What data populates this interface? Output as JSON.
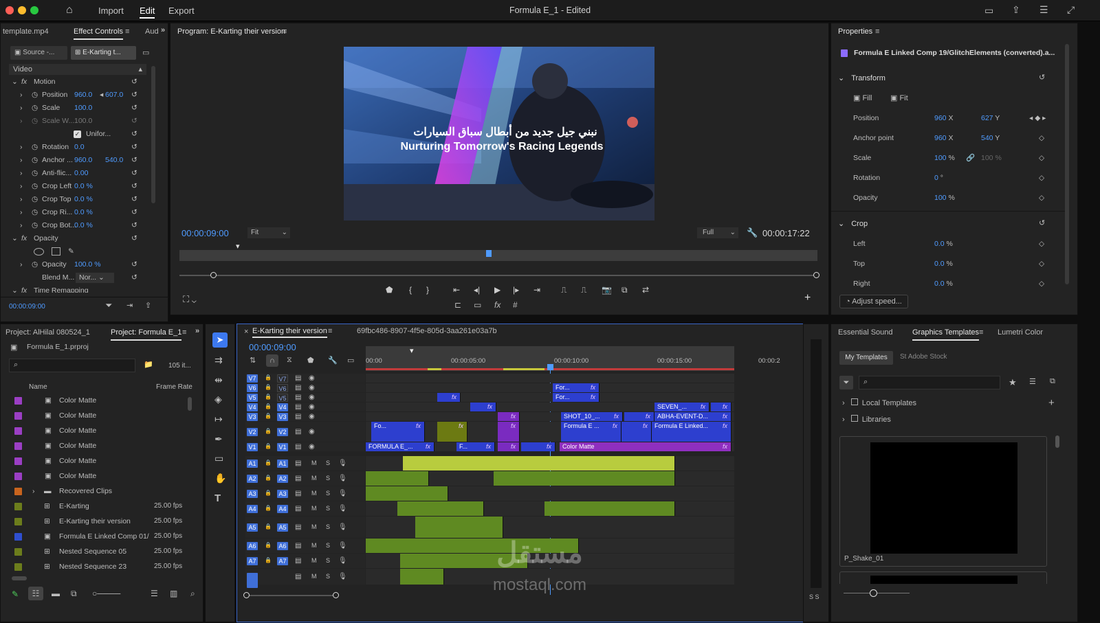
{
  "app": {
    "window_title": "Formula E_1 - Edited",
    "menu": [
      "Import",
      "Edit",
      "Export"
    ],
    "active_menu": "Edit"
  },
  "effect_controls": {
    "tabs": [
      "template.mp4",
      "Effect Controls",
      "Aud"
    ],
    "source_label": "Source -...",
    "clip_label": "E-Karting t...",
    "section": "Video",
    "timecode": "00:00:09:00",
    "rows": [
      {
        "label": "Motion",
        "value": "",
        "value2": ""
      },
      {
        "label": "Position",
        "value": "960.0",
        "value2": "607.0"
      },
      {
        "label": "Scale",
        "value": "100.0",
        "value2": ""
      },
      {
        "label": "Scale W...",
        "value": "100.0",
        "value2": ""
      },
      {
        "label": "Unifor...",
        "value": "",
        "value2": ""
      },
      {
        "label": "Rotation",
        "value": "0.0",
        "value2": ""
      },
      {
        "label": "Anchor ...",
        "value": "960.0",
        "value2": "540.0"
      },
      {
        "label": "Anti-flic...",
        "value": "0.00",
        "value2": ""
      },
      {
        "label": "Crop Left",
        "value": "0.0 %",
        "value2": ""
      },
      {
        "label": "Crop Top",
        "value": "0.0 %",
        "value2": ""
      },
      {
        "label": "Crop Ri...",
        "value": "0.0 %",
        "value2": ""
      },
      {
        "label": "Crop Bot...",
        "value": "0.0 %",
        "value2": ""
      },
      {
        "label": "Opacity",
        "value": "",
        "value2": ""
      },
      {
        "label": "Opacity",
        "value": "100.0 %",
        "value2": ""
      },
      {
        "label": "Blend M...",
        "value": "Nor...",
        "value2": ""
      },
      {
        "label": "Time Remapping",
        "value": "",
        "value2": ""
      }
    ]
  },
  "program": {
    "title": "Program: E-Karting their version",
    "timecode": "00:00:09:00",
    "zoom": "Fit",
    "resolution": "Full",
    "duration": "00:00:17:22",
    "overlay_arabic": "نبني جيل جديد من أبطال سباق السيارات",
    "overlay_english": "Nurturing Tomorrow's Racing Legends"
  },
  "properties": {
    "title": "Properties",
    "clip": "Formula E Linked Comp 19/GlitchElements (converted).a...",
    "transform_title": "Transform",
    "fill": "Fill",
    "fit": "Fit",
    "position_label": "Position",
    "position_x": "960",
    "position_y": "627",
    "anchor_label": "Anchor point",
    "anchor_x": "960",
    "anchor_y": "540",
    "scale_label": "Scale",
    "scale_value": "100",
    "scale_value2": "100",
    "rotation_label": "Rotation",
    "rotation_value": "0",
    "opacity_label": "Opacity",
    "opacity_value": "100",
    "crop_title": "Crop",
    "left_label": "Left",
    "left_value": "0.0",
    "top_label": "Top",
    "top_value": "0.0",
    "right_label": "Right",
    "right_value": "0.0",
    "x_unit": "X",
    "y_unit": "Y",
    "pct": "%",
    "deg": "°",
    "adjust_speed": "Adjust speed..."
  },
  "project": {
    "tabs": [
      "Project: AlHilal 080524_1",
      "Project: Formula E_1"
    ],
    "file": "Formula E_1.prproj",
    "count": "105 it...",
    "col_name": "Name",
    "col_rate": "Frame Rate",
    "items": [
      {
        "name": "Color Matte",
        "rate": "",
        "color": "#9b3fc4"
      },
      {
        "name": "Color Matte",
        "rate": "",
        "color": "#9b3fc4"
      },
      {
        "name": "Color Matte",
        "rate": "",
        "color": "#9b3fc4"
      },
      {
        "name": "Color Matte",
        "rate": "",
        "color": "#9b3fc4"
      },
      {
        "name": "Color Matte",
        "rate": "",
        "color": "#9b3fc4"
      },
      {
        "name": "Color Matte",
        "rate": "",
        "color": "#9b3fc4"
      },
      {
        "name": "Recovered Clips",
        "rate": "",
        "color": "#c8641e"
      },
      {
        "name": "E-Karting",
        "rate": "25.00 fps",
        "color": "#6c7d1c"
      },
      {
        "name": "E-Karting their version",
        "rate": "25.00 fps",
        "color": "#6c7d1c"
      },
      {
        "name": "Formula E Linked Comp 01/",
        "rate": "25.00 fps",
        "color": "#2f4fcf"
      },
      {
        "name": "Nested Sequence 05",
        "rate": "25.00 fps",
        "color": "#6c7d1c"
      },
      {
        "name": "Nested Sequence 23",
        "rate": "25.00 fps",
        "color": "#6c7d1c"
      }
    ]
  },
  "timeline": {
    "tab": "E-Karting their version",
    "tab2": "69fbc486-8907-4f5e-805d-3aa261e03a7b",
    "timecode": "00:00:09:00",
    "ruler": [
      "00:00",
      "00:00:05:00",
      "00:00:10:00",
      "00:00:15:00",
      "00:00:2"
    ],
    "video_tracks": [
      "V7",
      "V6",
      "V5",
      "V4",
      "V3",
      "V2",
      "V1"
    ],
    "audio_tracks": [
      "A1",
      "A2",
      "A3",
      "A4",
      "A5",
      "A6",
      "A7"
    ],
    "m": "M",
    "s": "S",
    "clips": {
      "v6a": "For...",
      "v5a": "For...",
      "v4a": "SEVEN_...",
      "v3a": "SHOT_10_...",
      "v3b": "ABHA-EVENT-D...",
      "v2a": "Fo...",
      "v2b": "Formula E ...",
      "v2c": "Formula E Linked...",
      "v1a": "FORMULA E_...",
      "v1b": "F...",
      "v1c": "Color Matte",
      "fx": "fx"
    }
  },
  "right_bottom": {
    "tabs": [
      "Essential Sound",
      "Graphics Templates",
      "Lumetri Color"
    ],
    "my_templates": "My Templates",
    "adobe_stock": "Adobe Stock",
    "local": "Local Templates",
    "libraries": "Libraries",
    "thumb": "P_Shake_01"
  },
  "meter": "S S",
  "watermark": {
    "arabic": "مستقل",
    "latin": "mostaql.com"
  }
}
